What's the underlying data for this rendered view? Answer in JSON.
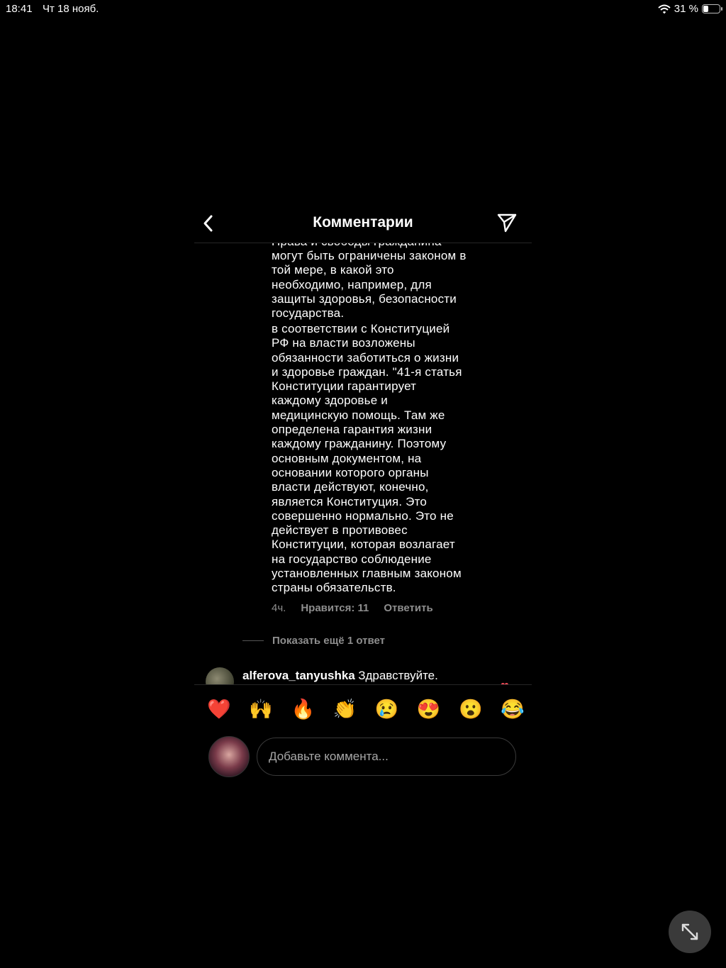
{
  "status_bar": {
    "time": "18:41",
    "date": "Чт 18 нояб.",
    "battery_percent": "31 %",
    "battery_level": 0.31
  },
  "header": {
    "title": "Комментарии",
    "back_icon": "chevron-left-icon",
    "send_icon": "paper-plane-icon"
  },
  "comment": {
    "partial_line": "Права и свободы гражданина",
    "paragraph1_lines": [
      "могут быть ограничены законом в",
      "той мере, в какой это",
      "необходимо, например, для",
      "защиты здоровья, безопасности",
      "государства."
    ],
    "paragraph2_lines": [
      "в соответствии с Конституцией",
      "РФ на власти возложены",
      "обязанности заботиться о жизни",
      "и здоровье граждан. \"41-я статья",
      "Конституции гарантирует",
      "каждому здоровье и",
      "медицинскую помощь. Там же",
      "определена гарантия жизни",
      "каждому гражданину. Поэтому",
      "основным документом, на",
      "основании которого органы",
      "власти действуют, конечно,",
      "является Конституция. Это",
      "совершенно нормально. Это не",
      "действует в противовес",
      "Конституции, которая возлагает",
      "на государство соблюдение",
      "установленных главным законом",
      "страны обязательств."
    ],
    "time": "4ч.",
    "likes": "Нравится: 11",
    "reply": "Ответить"
  },
  "show_more_replies": "Показать ещё 1 ответ",
  "next_comment": {
    "username": "alferova_tanyushka",
    "text": "Здравствуйте."
  },
  "reactions": [
    "❤️",
    "🙌",
    "🔥",
    "👏",
    "😢",
    "😍",
    "😮",
    "😂"
  ],
  "composer": {
    "placeholder": "Добавьте коммента..."
  },
  "colors": {
    "background": "#000000",
    "text": "#ffffff",
    "secondary": "#8e8e8e",
    "heart": "#ed4956"
  }
}
